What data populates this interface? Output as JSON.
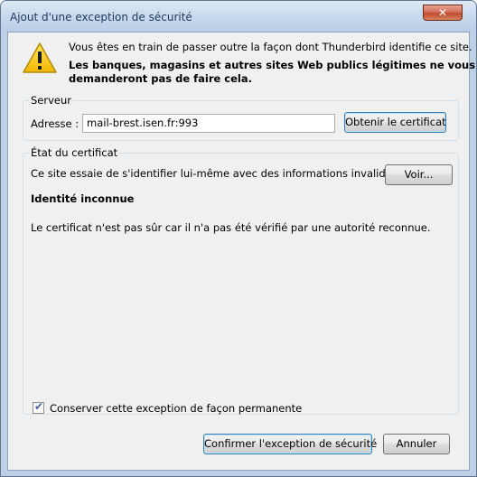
{
  "window": {
    "title": "Ajout d'une exception de sécurité",
    "close_label": "✕"
  },
  "intro": {
    "line1": "Vous êtes en train de passer outre la façon dont Thunderbird identifie ce site.",
    "bold_line1": "Les banques, magasins et autres sites Web publics légitimes ne vous",
    "bold_line2": "demanderont pas de faire cela."
  },
  "server": {
    "group_label": "Serveur",
    "address_label": "Adresse :",
    "address_value": "mail-brest.isen.fr:993",
    "fetch_button": "Obtenir le certificat"
  },
  "certificate": {
    "group_label": "État du certificat",
    "status_text": "Ce site essaie de s'identifier lui-même avec des informations invalides.",
    "view_button": "Voir...",
    "identity_title": "Identité inconnue",
    "detail_text": "Le certificat n'est pas sûr car il n'a pas été vérifié par une autorité reconnue."
  },
  "permanent": {
    "label": "Conserver cette exception de façon permanente",
    "checked": true,
    "check_glyph": "✔"
  },
  "footer": {
    "confirm_button": "Confirmer l'exception de sécurité",
    "cancel_button": "Annuler"
  },
  "icons": {
    "warning": "warning-triangle-icon",
    "close": "close-icon",
    "checkbox": "checkmark-icon"
  },
  "colors": {
    "titlebar": "#c9dbee",
    "close_button": "#c24a30",
    "dialog_bg": "#f0f0f0",
    "warning_yellow": "#f5c400"
  }
}
